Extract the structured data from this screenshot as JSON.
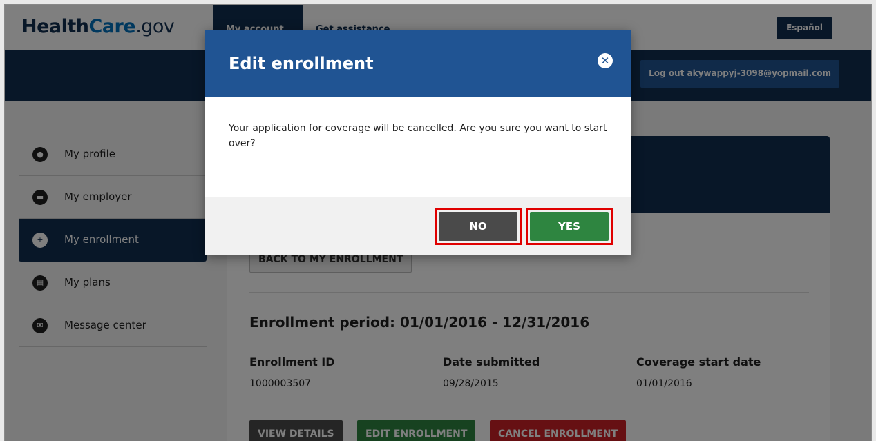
{
  "header": {
    "logo_part1": "Health",
    "logo_part2": "Care",
    "logo_part3": ".gov",
    "tabs": [
      {
        "label": "My account"
      },
      {
        "label": "Get assistance"
      }
    ],
    "language_button": "Español",
    "logout_button": "Log out akywappyj-3098@yopmail.com"
  },
  "sidebar": {
    "items": [
      {
        "label": "My profile",
        "icon": "person-icon"
      },
      {
        "label": "My employer",
        "icon": "briefcase-icon"
      },
      {
        "label": "My enrollment",
        "icon": "medical-bag-icon",
        "active": true
      },
      {
        "label": "My plans",
        "icon": "document-icon"
      },
      {
        "label": "Message center",
        "icon": "envelope-icon"
      }
    ]
  },
  "main": {
    "back_button": "BACK TO MY ENROLLMENT",
    "enrollment_period_label": "Enrollment period:",
    "enrollment_period_value": "01/01/2016 - 12/31/2016",
    "columns": [
      {
        "header": "Enrollment ID",
        "value": "1000003507"
      },
      {
        "header": "Date submitted",
        "value": "09/28/2015"
      },
      {
        "header": "Coverage start date",
        "value": "01/01/2016"
      }
    ],
    "actions": {
      "view": "VIEW DETAILS",
      "edit": "EDIT ENROLLMENT",
      "cancel": "CANCEL ENROLLMENT"
    }
  },
  "modal": {
    "title": "Edit enrollment",
    "message": "Your application for coverage will be cancelled. Are you sure you want to start over?",
    "no_button": "NO",
    "yes_button": "YES"
  },
  "colors": {
    "navy": "#112e51",
    "modal_blue": "#205493",
    "green": "#2e8540",
    "red": "#cd2026",
    "highlight": "#e00000"
  }
}
